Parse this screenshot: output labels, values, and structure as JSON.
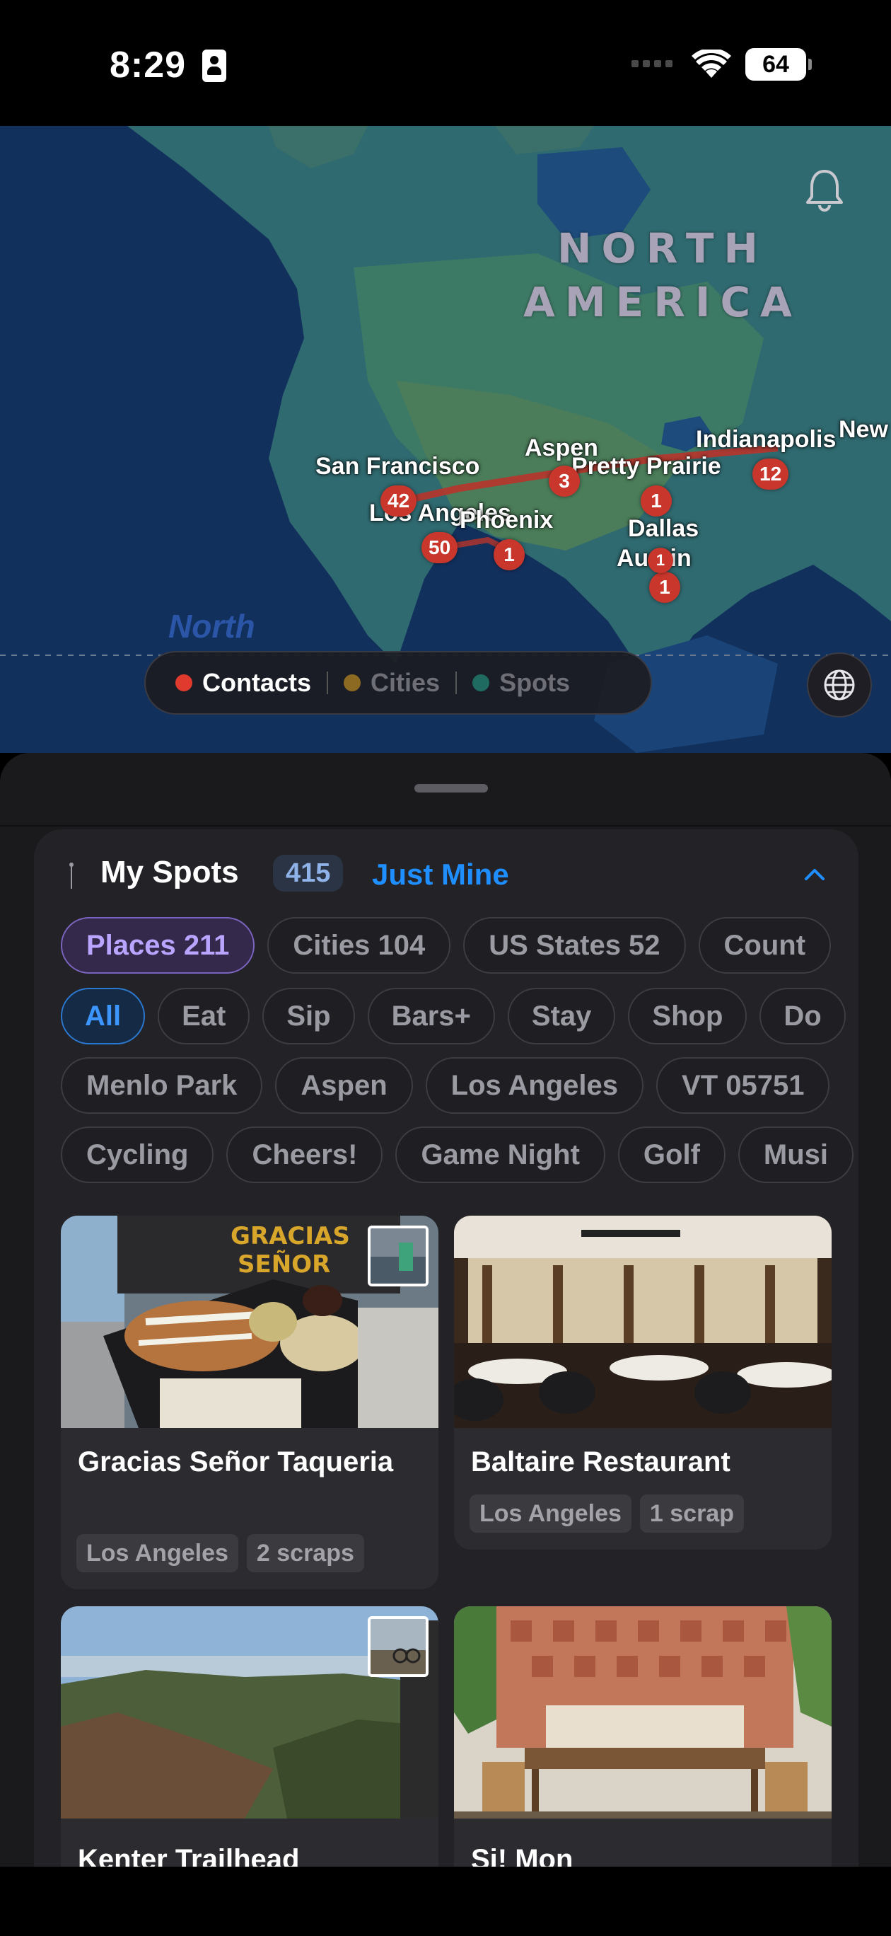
{
  "status_bar": {
    "time": "8:29",
    "battery": "64"
  },
  "map": {
    "continent_lines": [
      "NORTH",
      "AMERICA"
    ],
    "city_labels": [
      "San Francisco",
      "Los Angeles",
      "Phoenix",
      "Aspen",
      "Pretty Prairie",
      "Dallas",
      "Austin",
      "Indianapolis",
      "New"
    ],
    "clusters": [
      "42",
      "50",
      "1",
      "3",
      "1",
      "1",
      "1",
      "12"
    ],
    "ocean_label": "North",
    "legend": [
      {
        "label": "Contacts",
        "color": "#e03a2e"
      },
      {
        "label": "Cities",
        "color": "#8c6a22"
      },
      {
        "label": "Spots",
        "color": "#1f6b62"
      }
    ]
  },
  "spots": {
    "title": "My Spots",
    "count": "415",
    "filter_label": "Just Mine",
    "scope_chips": [
      "Places 211",
      "Cities 104",
      "US States 52",
      "Count"
    ],
    "category_chips": [
      "All",
      "Eat",
      "Sip",
      "Bars+",
      "Stay",
      "Shop",
      "Do"
    ],
    "place_chips": [
      "Menlo Park",
      "Aspen",
      "Los Angeles",
      "VT 05751"
    ],
    "tag_chips": [
      "Cycling",
      "Cheers!",
      "Game Night",
      "Golf",
      "Musi"
    ],
    "cards": [
      {
        "name": "Gracias Señor Taqueria",
        "tags": [
          "Los Angeles",
          "2 scraps"
        ]
      },
      {
        "name": "Baltaire Restaurant",
        "tags": [
          "Los Angeles",
          "1 scrap"
        ]
      },
      {
        "name": "Kenter Trailhead",
        "tags": []
      },
      {
        "name": "Si! Mon",
        "tags": []
      }
    ]
  }
}
